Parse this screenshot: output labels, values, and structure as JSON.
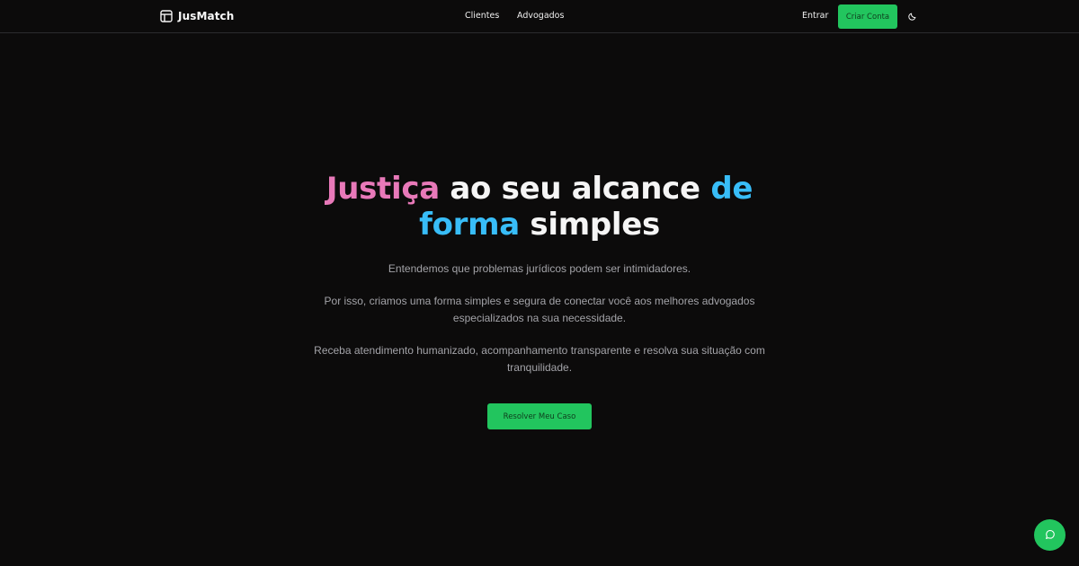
{
  "header": {
    "brand": "JusMatch",
    "brand_icon": "layout-panel-icon",
    "nav": [
      {
        "label": "Clientes"
      },
      {
        "label": "Advogados"
      }
    ],
    "login_label": "Entrar",
    "signup_label": "Criar Conta",
    "theme_icon": "moon-icon"
  },
  "hero": {
    "title_part1": "Justiça",
    "title_part2": " ao seu alcance ",
    "title_part3": "de",
    "title_part4": "forma",
    "title_part5": " simples",
    "paragraph1": "Entendemos que problemas jurídicos podem ser intimidadores.",
    "paragraph2": "Por isso, criamos uma forma simples e segura de conectar você aos melhores advogados especializados na sua necessidade.",
    "paragraph3": "Receba atendimento humanizado, acompanhamento transparente e resolva sua situação com tranquilidade.",
    "cta_label": "Resolver Meu Caso"
  },
  "chat": {
    "icon": "chat-bubble-icon"
  },
  "colors": {
    "background": "#0c0b0b",
    "accent_green": "#22c55e",
    "title_pink": "#e879b9",
    "title_blue": "#38bdf8",
    "muted_text": "#a3a3a8"
  }
}
